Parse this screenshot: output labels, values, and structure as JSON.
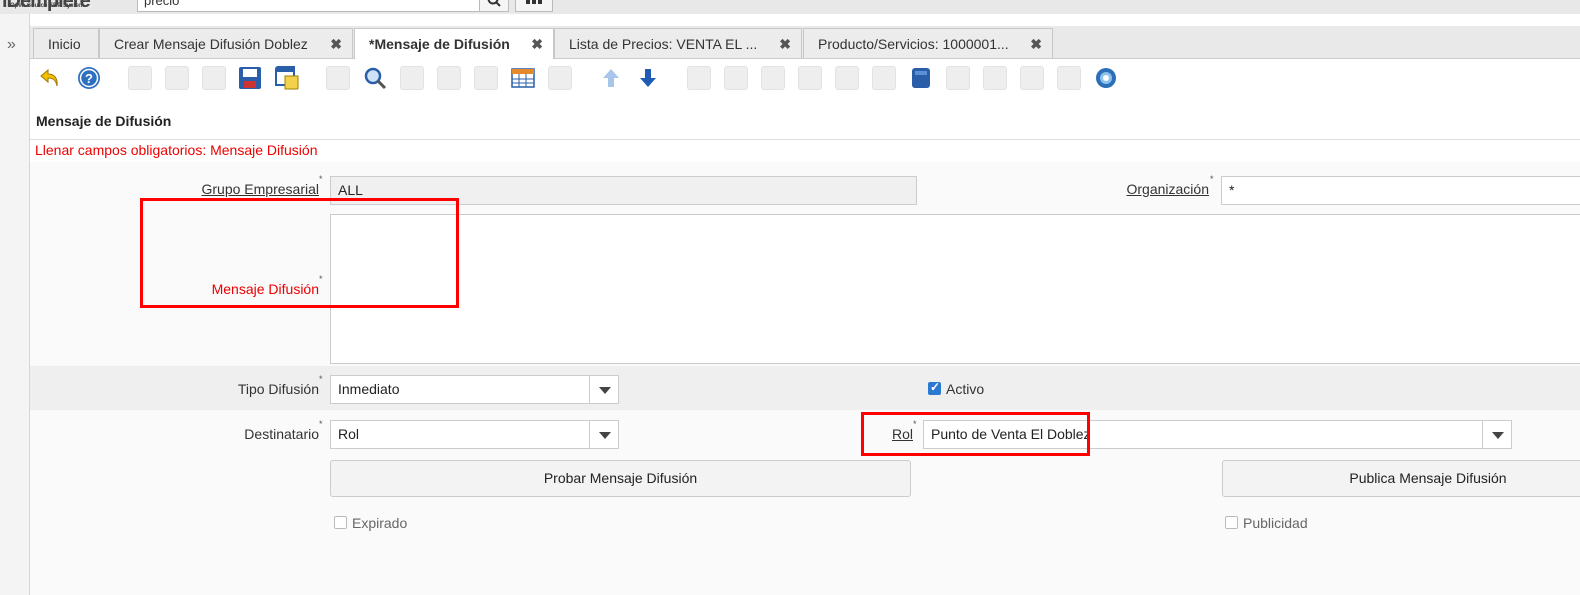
{
  "header": {
    "logo": "iDempiere",
    "logo_sub": "Open Source ERP System",
    "search_value": "precio"
  },
  "tabs": [
    {
      "label": "Inicio"
    },
    {
      "label": "Crear Mensaje Difusión Doblez"
    },
    {
      "label": "*Mensaje de Difusión"
    },
    {
      "label": "Lista de Precios: VENTA EL ..."
    },
    {
      "label": "Producto/Servicios: 1000001..."
    }
  ],
  "window": {
    "title": "Mensaje de Difusión",
    "error": "Llenar campos obligatorios: Mensaje Difusión"
  },
  "form": {
    "grupo_label": "Grupo Empresarial",
    "grupo_value": "ALL",
    "org_label": "Organización",
    "org_value": "*",
    "mensaje_label": "Mensaje Difusión",
    "tipo_label": "Tipo Difusión",
    "tipo_value": "Inmediato",
    "activo_label": "Activo",
    "destinatario_label": "Destinatario",
    "destinatario_value": "Rol",
    "rol_label": "Rol",
    "rol_value": "Punto de Venta El Doblez",
    "probar_button": "Probar Mensaje Difusión",
    "publica_button": "Publica Mensaje Difusión",
    "expirado_label": "Expirado",
    "publicidad_label": "Publicidad",
    "required_mark": "*"
  },
  "colors": {
    "error": "#e00000",
    "highlight": "#ff0000",
    "checkbox": "#2b79d0"
  }
}
